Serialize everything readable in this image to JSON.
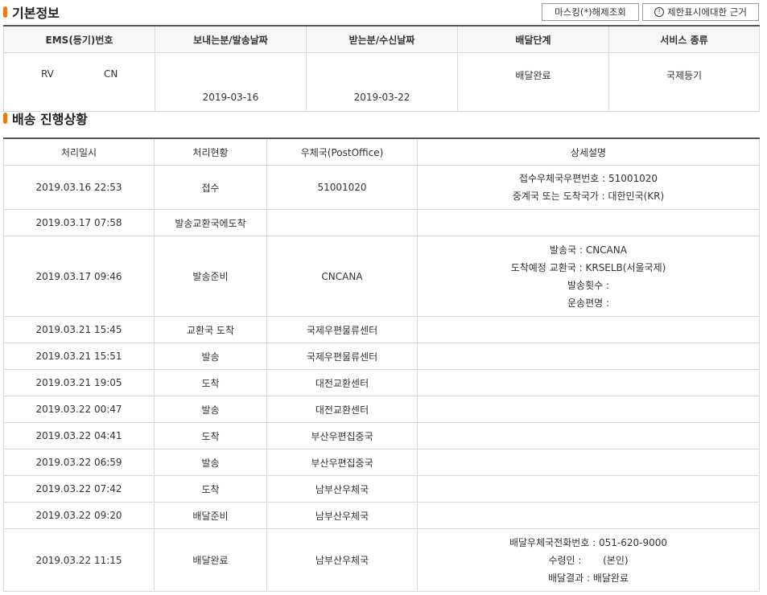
{
  "basic": {
    "title": "기본정보",
    "buttons": {
      "masking": "마스킹(*)해제조회",
      "limit_info": "제한표시에대한 근거",
      "limit_icon": "!"
    },
    "headers": [
      "EMS(등기)번호",
      "보내는분/발송날짜",
      "받는분/수신날짜",
      "배달단계",
      "서비스 종류"
    ],
    "row": {
      "ems_prefix": "RV",
      "ems_suffix": "CN",
      "send_date": "2019-03-16",
      "recv_date": "2019-03-22",
      "stage": "배달완료",
      "service": "국제등기"
    }
  },
  "progress": {
    "title": "배송 진행상황",
    "headers": [
      "처리일시",
      "처리현황",
      "우체국(PostOffice)",
      "상세설명"
    ],
    "rows": [
      {
        "datetime": "2019.03.16 22:53",
        "status": "접수",
        "office": "51001020",
        "details": [
          "접수우체국우편번호 : 51001020",
          "중계국 또는 도착국가 : 대한민국(KR)"
        ]
      },
      {
        "datetime": "2019.03.17 07:58",
        "status": "발송교환국에도착",
        "office": "",
        "details": []
      },
      {
        "datetime": "2019.03.17 09:46",
        "status": "발송준비",
        "office": "CNCANA",
        "details": [
          "발송국 : CNCANA",
          "도착예정 교환국 : KRSELB(서울국제)",
          "발송횟수 :",
          "운송편명 :"
        ]
      },
      {
        "datetime": "2019.03.21 15:45",
        "status": "교환국 도착",
        "office": "국제우편물류센터",
        "details": []
      },
      {
        "datetime": "2019.03.21 15:51",
        "status": "발송",
        "office": "국제우편물류센터",
        "details": []
      },
      {
        "datetime": "2019.03.21 19:05",
        "status": "도착",
        "office": "대전교환센터",
        "details": []
      },
      {
        "datetime": "2019.03.22 00:47",
        "status": "발송",
        "office": "대전교환센터",
        "details": []
      },
      {
        "datetime": "2019.03.22 04:41",
        "status": "도착",
        "office": "부산우편집중국",
        "details": []
      },
      {
        "datetime": "2019.03.22 06:59",
        "status": "발송",
        "office": "부산우편집중국",
        "details": []
      },
      {
        "datetime": "2019.03.22 07:42",
        "status": "도착",
        "office": "남부산우체국",
        "details": []
      },
      {
        "datetime": "2019.03.22 09:20",
        "status": "배달준비",
        "office": "남부산우체국",
        "details": []
      },
      {
        "datetime": "2019.03.22 11:15",
        "status": "배달완료",
        "office": "남부산우체국",
        "details": [
          "배달우체국전화번호 : 051-620-9000",
          "수령인 :       (본인)",
          "배달결과 : 배달완료"
        ]
      }
    ]
  },
  "colors": {
    "marker": "#e8791d",
    "header_bg": "#f7f7f7",
    "border": "#d9d9d9"
  }
}
